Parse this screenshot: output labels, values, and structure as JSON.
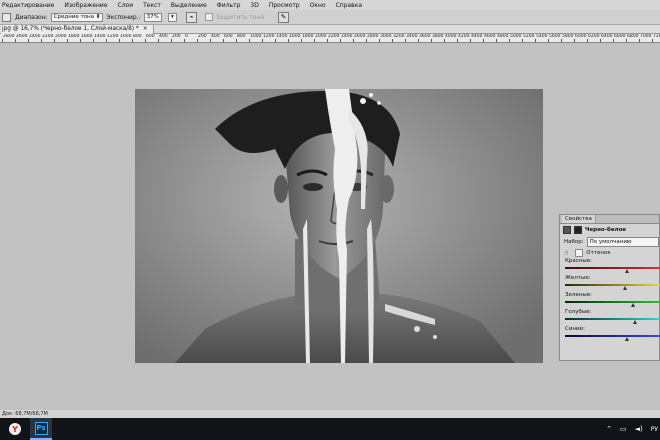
{
  "menu": [
    "Редактирование",
    "Изображение",
    "Слои",
    "Текст",
    "Выделение",
    "Фильтр",
    "3D",
    "Просмотр",
    "Окно",
    "Справка"
  ],
  "options": {
    "range_label": "Диапазон:",
    "range_value": "Средние тона",
    "exposure_label": "Экспонир.:",
    "exposure_value": "37%",
    "protect_tones": "Защитить тона"
  },
  "doc_tab": "jpg @ 16,7% (Черно-белое 1, Слой-маска/8) *",
  "ruler": [
    "2800",
    "2600",
    "2400",
    "2200",
    "2000",
    "1800",
    "1600",
    "1400",
    "1200",
    "1000",
    "800",
    "600",
    "400",
    "200",
    "0",
    "200",
    "400",
    "600",
    "800",
    "1000",
    "1200",
    "1400",
    "1600",
    "1800",
    "2000",
    "2200",
    "2400",
    "2600",
    "2800",
    "3000",
    "3200",
    "3400",
    "3600",
    "3800",
    "4000",
    "4200",
    "4400",
    "4600",
    "4800",
    "5000",
    "5200",
    "5400",
    "5600",
    "5800",
    "6000",
    "6200",
    "6400",
    "6600",
    "6800",
    "7000",
    "7200"
  ],
  "properties": {
    "tab": "Свойства",
    "title": "Черно-белое",
    "preset_label": "Набор:",
    "preset_value": "По умолчанию",
    "tint_label": "Оттенок",
    "sliders": [
      {
        "label": "Красные:",
        "value": 0.62,
        "gradient": "linear-gradient(90deg,#3b0b0b,#e03232)"
      },
      {
        "label": "Желтые:",
        "value": 0.6,
        "gradient": "linear-gradient(90deg,#2a2a05,#e7e33a)"
      },
      {
        "label": "Зеленые:",
        "value": 0.68,
        "gradient": "linear-gradient(90deg,#062a08,#33c23b)"
      },
      {
        "label": "Голубые:",
        "value": 0.7,
        "gradient": "linear-gradient(90deg,#053030,#36d8e0)"
      },
      {
        "label": "Синие:",
        "value": 0.62,
        "gradient": "linear-gradient(90deg,#060833,#3a4ee8)"
      }
    ]
  },
  "status": "Док: 68,7M/68,7M",
  "taskbar": {
    "yandex_glyph": "Y",
    "ps_glyph": "Ps",
    "lang": "РУ"
  }
}
